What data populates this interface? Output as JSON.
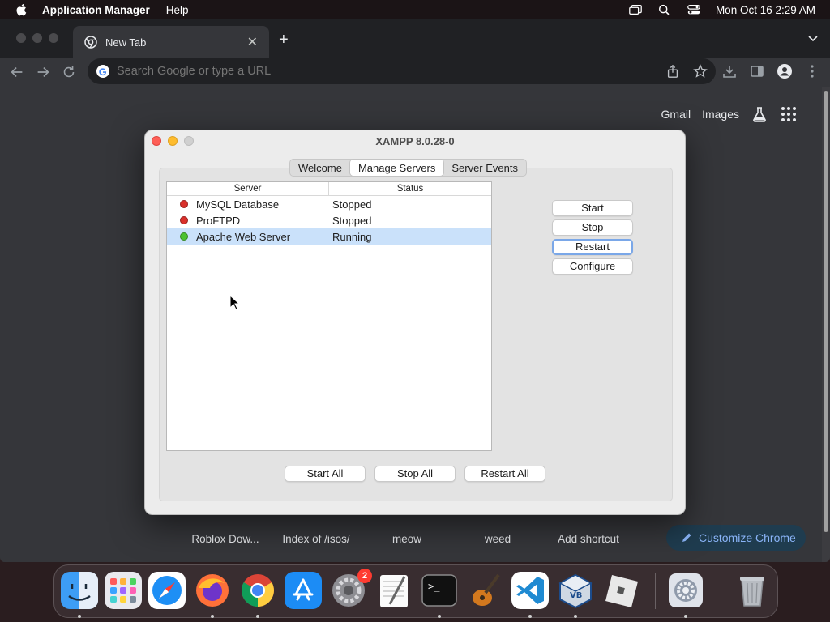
{
  "menubar": {
    "app_name": "Application Manager",
    "items": [
      "Help"
    ],
    "datetime": "Mon Oct 16  2:29 AM"
  },
  "chrome": {
    "tab_title": "New Tab",
    "new_tab_symbol": "+",
    "tab_close_symbol": "✕",
    "omnibox_placeholder": "Search Google or type a URL",
    "ntp_links": {
      "gmail": "Gmail",
      "images": "Images"
    },
    "shortcuts": [
      "Roblox Dow...",
      "Index of /isos/",
      "meow",
      "weed",
      "Add shortcut"
    ],
    "customize_label": "Customize Chrome"
  },
  "xampp": {
    "title": "XAMPP 8.0.28-0",
    "tabs": [
      "Welcome",
      "Manage Servers",
      "Server Events"
    ],
    "active_tab": "Manage Servers",
    "table": {
      "headers": [
        "Server",
        "Status"
      ],
      "rows": [
        {
          "name": "MySQL Database",
          "status": "Stopped",
          "color": "#d9302b"
        },
        {
          "name": "ProFTPD",
          "status": "Stopped",
          "color": "#d9302b"
        },
        {
          "name": "Apache Web Server",
          "status": "Running",
          "color": "#4cc230"
        }
      ]
    },
    "side_buttons": {
      "start": "Start",
      "stop": "Stop",
      "restart": "Restart",
      "configure": "Configure"
    },
    "bottom_buttons": {
      "start_all": "Start All",
      "stop_all": "Stop All",
      "restart_all": "Restart All"
    }
  },
  "dock": {
    "icons": [
      "finder-icon",
      "launchpad-icon",
      "safari-icon",
      "firefox-icon",
      "chrome-icon",
      "app-store-icon",
      "system-preferences-icon",
      "textedit-icon",
      "terminal-icon",
      "garageband-icon",
      "vscode-icon",
      "virtualbox-icon",
      "roblox-icon",
      "xampp-manager-icon",
      "trash-icon"
    ],
    "system_preferences_badge": "2"
  },
  "colors": {
    "selected_row": "#cae1fa",
    "stopped": "#d9302b",
    "running": "#4cc230",
    "chrome_bg": "#35363a"
  }
}
